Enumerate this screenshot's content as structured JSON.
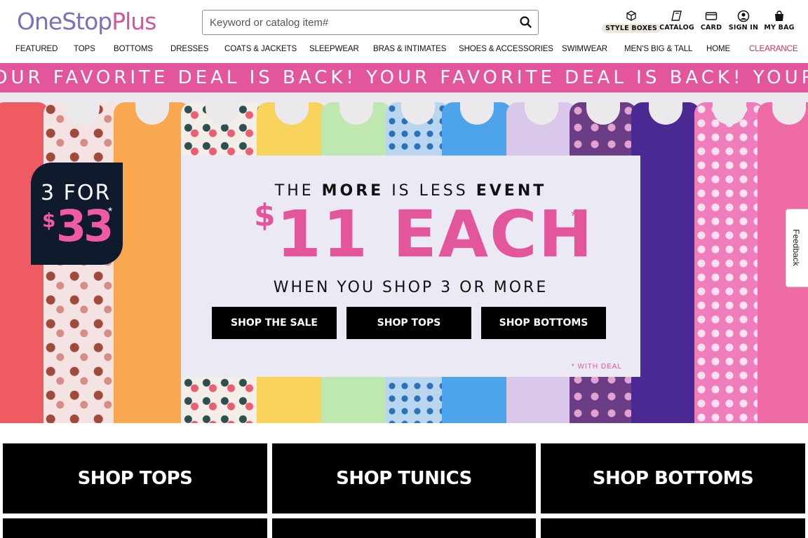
{
  "header": {
    "logo_part1": "OneStop",
    "logo_part2": "Plus",
    "search": {
      "placeholder": "Keyword or catalog item#",
      "button_icon": "search-icon"
    },
    "utilities": [
      {
        "label": "STYLE BOXES",
        "icon": "box-icon"
      },
      {
        "label": "CATALOG",
        "icon": "catalog-icon"
      },
      {
        "label": "CARD",
        "icon": "card-icon"
      },
      {
        "label": "SIGN IN",
        "icon": "user-icon"
      },
      {
        "label": "MY BAG",
        "icon": "bag-icon"
      }
    ]
  },
  "nav": {
    "items": [
      "FEATURED",
      "TOPS",
      "BOTTOMS",
      "DRESSES",
      "COATS & JACKETS",
      "SLEEPWEAR",
      "BRAS & INTIMATES",
      "SHOES & ACCESSORIES",
      "SWIMWEAR",
      "MEN'S BIG & TALL",
      "HOME",
      "CLEARANCE"
    ]
  },
  "marquee": {
    "text": "OUR FAVORITE DEAL IS BACK! YOUR FAVORITE DEAL IS BACK! YOUR FA"
  },
  "hero": {
    "badge": {
      "line1": "3 FOR",
      "dollar": "$",
      "price": "33",
      "star": "*"
    },
    "panel": {
      "eyebrow_1": "THE ",
      "eyebrow_2": "MORE",
      "eyebrow_3": " IS LESS ",
      "eyebrow_4": "EVENT",
      "dollar": "$",
      "headline": "11 EACH",
      "headline_star": "*",
      "sub": "WHEN YOU SHOP 3 OR MORE",
      "buttons": [
        "SHOP THE SALE",
        "SHOP TOPS",
        "SHOP BOTTOMS"
      ],
      "note": "* WITH DEAL"
    },
    "feedback": "Feedback"
  },
  "tiles": [
    "SHOP TOPS",
    "SHOP TUNICS",
    "SHOP BOTTOMS"
  ],
  "colors": {
    "brand_purple": "#7d6fb8",
    "brand_pink": "#d2569b",
    "banner_pink": "#e4569c",
    "badge_navy": "#0f1b2d",
    "clearance_red": "#c0344f"
  }
}
